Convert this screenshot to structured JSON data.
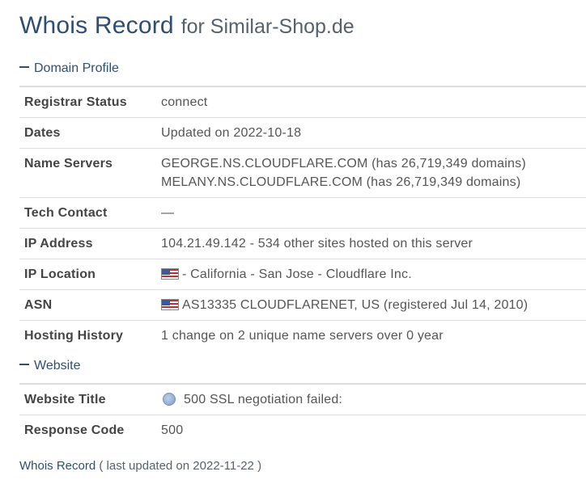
{
  "header": {
    "title": "Whois Record",
    "subtitle": "for Similar-Shop.de"
  },
  "domain_profile": {
    "heading": "Domain Profile",
    "rows": [
      {
        "label": "Registrar Status",
        "lines": [
          "connect"
        ]
      },
      {
        "label": "Dates",
        "lines": [
          "Updated on 2022-10-18"
        ]
      },
      {
        "label": "Name Servers",
        "lines": [
          "GEORGE.NS.CLOUDFLARE.COM (has 26,719,349 domains)",
          "MELANY.NS.CLOUDFLARE.COM (has 26,719,349 domains)"
        ]
      },
      {
        "label": "Tech Contact",
        "lines": [
          "—"
        ]
      },
      {
        "label": "IP Address",
        "lines": [
          "104.21.49.142 - 534 other sites hosted on this server"
        ]
      },
      {
        "label": "IP Location",
        "lines": [
          "- California - San Jose - Cloudflare Inc."
        ],
        "icon": "us-flag-icon"
      },
      {
        "label": "ASN",
        "lines": [
          "AS13335 CLOUDFLARENET, US (registered Jul 14, 2010)"
        ],
        "icon": "us-flag-icon"
      },
      {
        "label": "Hosting History",
        "lines": [
          "1 change on 2 unique name servers over 0 year"
        ]
      }
    ]
  },
  "website": {
    "heading": "Website",
    "rows": [
      {
        "label": "Website Title",
        "lines": [
          "500 SSL negotiation failed:"
        ],
        "icon": "globe-icon"
      },
      {
        "label": "Response Code",
        "lines": [
          "500"
        ]
      }
    ]
  },
  "footer": {
    "link": "Whois Record",
    "updated": "( last updated on 2022-11-22 )"
  },
  "colors": {
    "accent": "#2f4e72",
    "border": "#dddddd"
  }
}
